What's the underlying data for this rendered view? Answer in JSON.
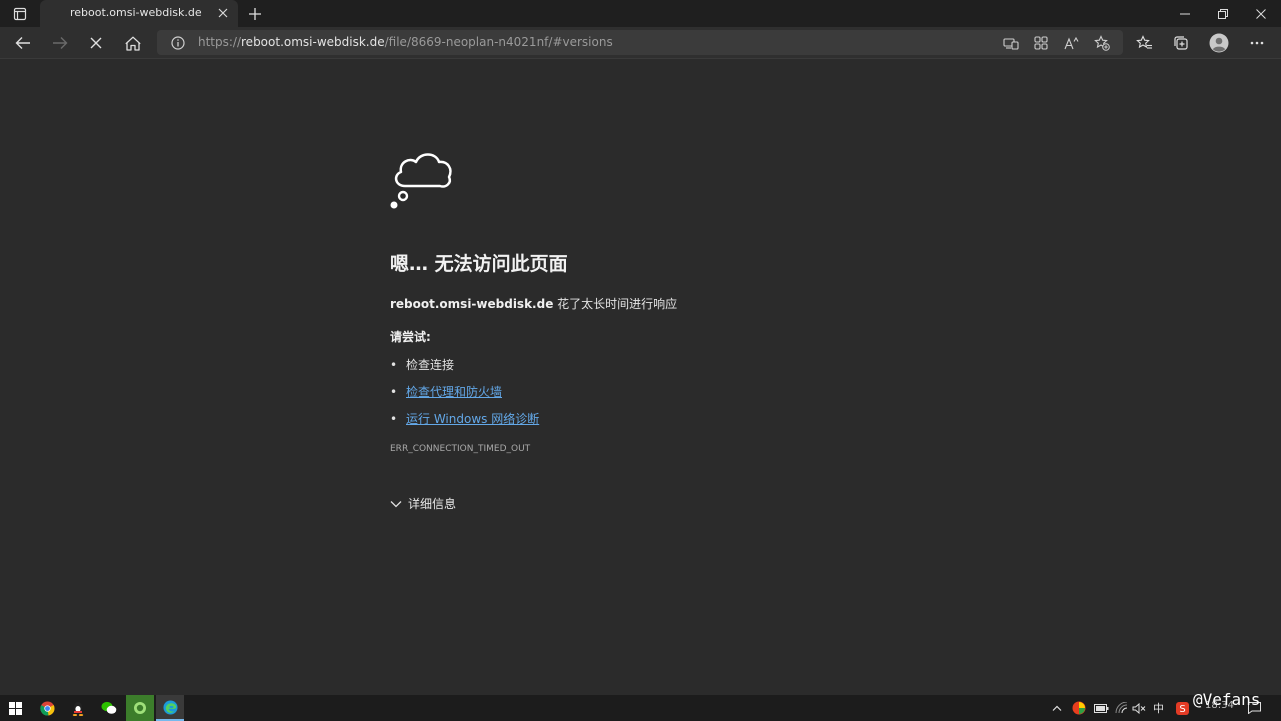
{
  "browser": {
    "tab": {
      "title": "reboot.omsi-webdisk.de"
    },
    "address_bar": {
      "scheme": "https://",
      "host": "reboot.omsi-webdisk.de",
      "path": "/file/8669-neoplan-n4021nf/#versions"
    }
  },
  "error_page": {
    "heading": "嗯… 无法访问此页面",
    "host_bold": "reboot.omsi-webdisk.de",
    "message_rest": " 花了太长时间进行响应",
    "try_label": "请尝试:",
    "suggestions": [
      {
        "text": "检查连接",
        "link": false
      },
      {
        "text": "检查代理和防火墙",
        "link": true
      },
      {
        "text": "运行 Windows 网络诊断",
        "link": true
      }
    ],
    "error_code": "ERR_CONNECTION_TIMED_OUT",
    "details_label": "详细信息"
  },
  "taskbar": {
    "ime": "中",
    "clock": "18:34"
  },
  "watermark": "@Vefans",
  "colors": {
    "page_bg": "#2b2b2b",
    "link": "#63a8e8",
    "titlebar": "#1f1f1f",
    "taskbar": "#1c1c1c"
  }
}
